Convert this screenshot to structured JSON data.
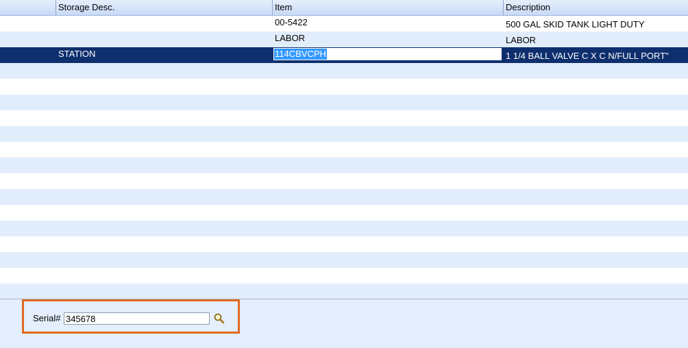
{
  "columns": {
    "storage_desc": "Storage Desc.",
    "item": "Item",
    "description": "Description"
  },
  "rows": [
    {
      "storage_desc": "",
      "item": "00-5422",
      "description": "500 GAL SKID TANK LIGHT DUTY"
    },
    {
      "storage_desc": "",
      "item": "LABOR",
      "description": "LABOR"
    },
    {
      "storage_desc": "STATION",
      "item": "114CBVCPH",
      "description": "1 1/4 BALL VALVE C X C N/FULL PORT\""
    }
  ],
  "serial": {
    "label": "Serial#",
    "value": "345678",
    "lookup_icon": "magnifier-icon"
  },
  "colors": {
    "selected_row": "#0e2f6e",
    "alt_row": "#e2edfc",
    "highlight_border": "#e06b1f"
  }
}
